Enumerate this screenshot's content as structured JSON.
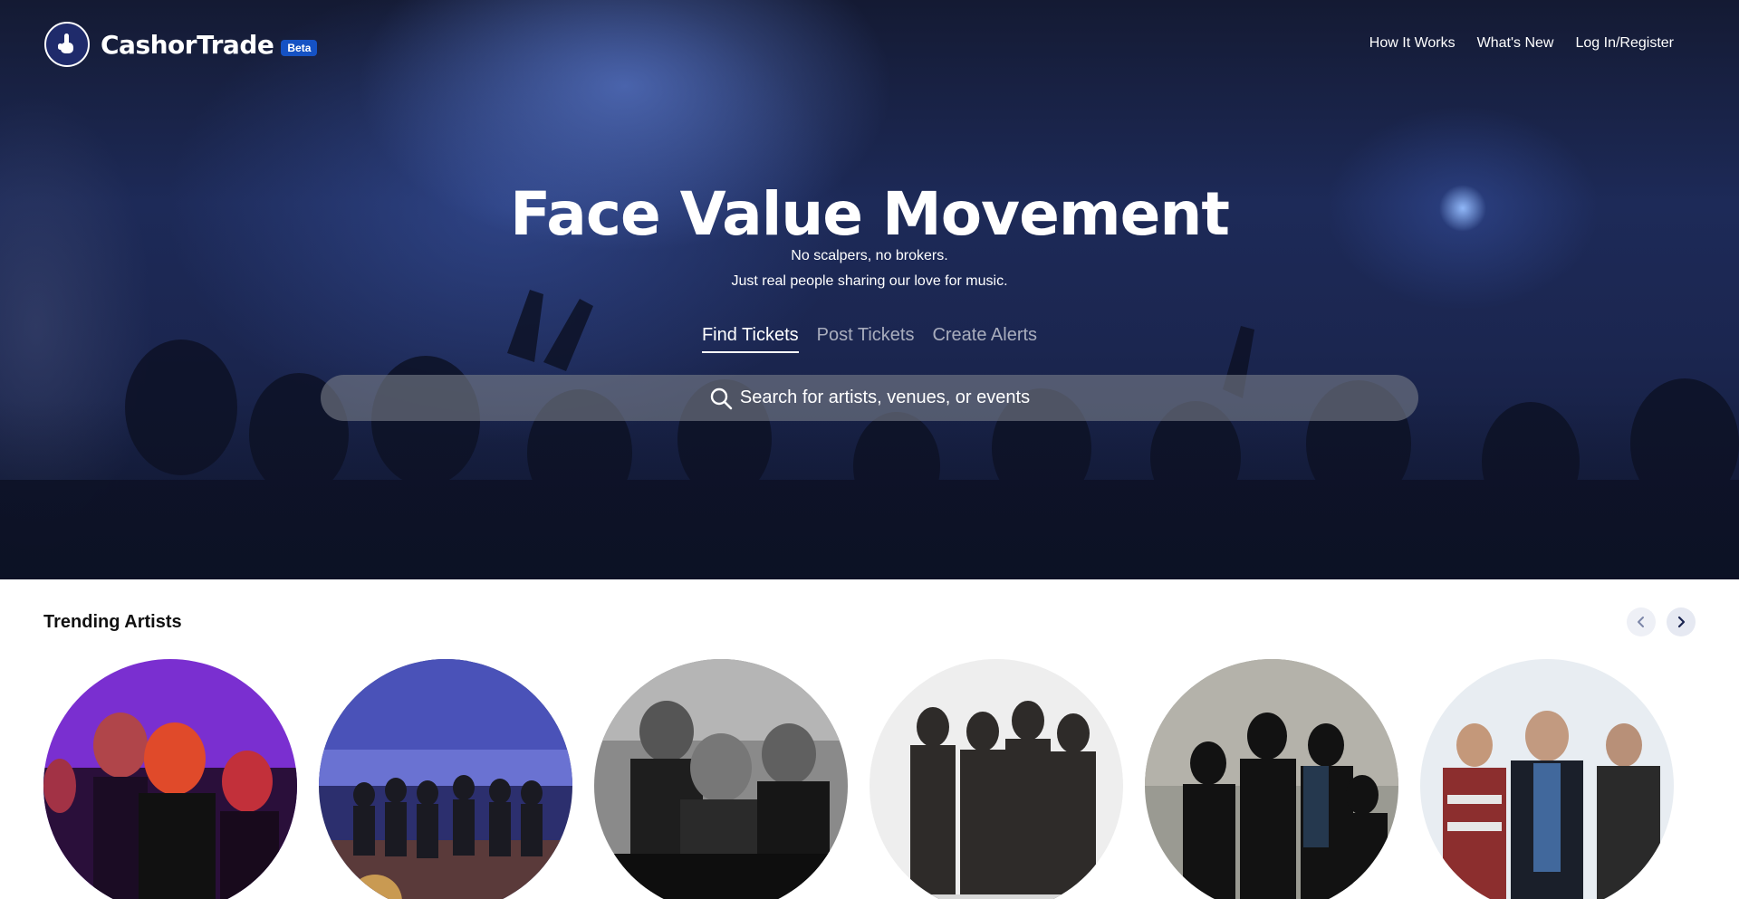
{
  "brand": {
    "name": "CashorTrade",
    "badge": "Beta"
  },
  "nav": {
    "items": [
      {
        "label": "How It Works"
      },
      {
        "label": "What's New"
      },
      {
        "label": "Log In/Register"
      }
    ]
  },
  "hero": {
    "title": "Face Value Movement",
    "tagline_1": "No scalpers, no brokers.",
    "tagline_2": "Just real people sharing our love for music.",
    "tabs": [
      {
        "label": "Find Tickets",
        "active": true
      },
      {
        "label": "Post Tickets",
        "active": false
      },
      {
        "label": "Create Alerts",
        "active": false
      }
    ],
    "search": {
      "placeholder": "Search for artists, venues, or events",
      "icon": "search-icon"
    }
  },
  "trending": {
    "title": "Trending Artists",
    "prev_icon": "chevron-left-icon",
    "next_icon": "chevron-right-icon",
    "artists": [
      {
        "image": "band-photo-red-purple"
      },
      {
        "image": "band-photo-stage-crowd"
      },
      {
        "image": "band-photo-black-white"
      },
      {
        "image": "band-photo-jumpsuits"
      },
      {
        "image": "band-photo-concrete-wall"
      },
      {
        "image": "band-photo-outdoor-sky"
      }
    ]
  },
  "colors": {
    "hero_base": "#1b2650",
    "beta_badge": "#1552c4",
    "logo_circle": "#1f2b6b"
  }
}
